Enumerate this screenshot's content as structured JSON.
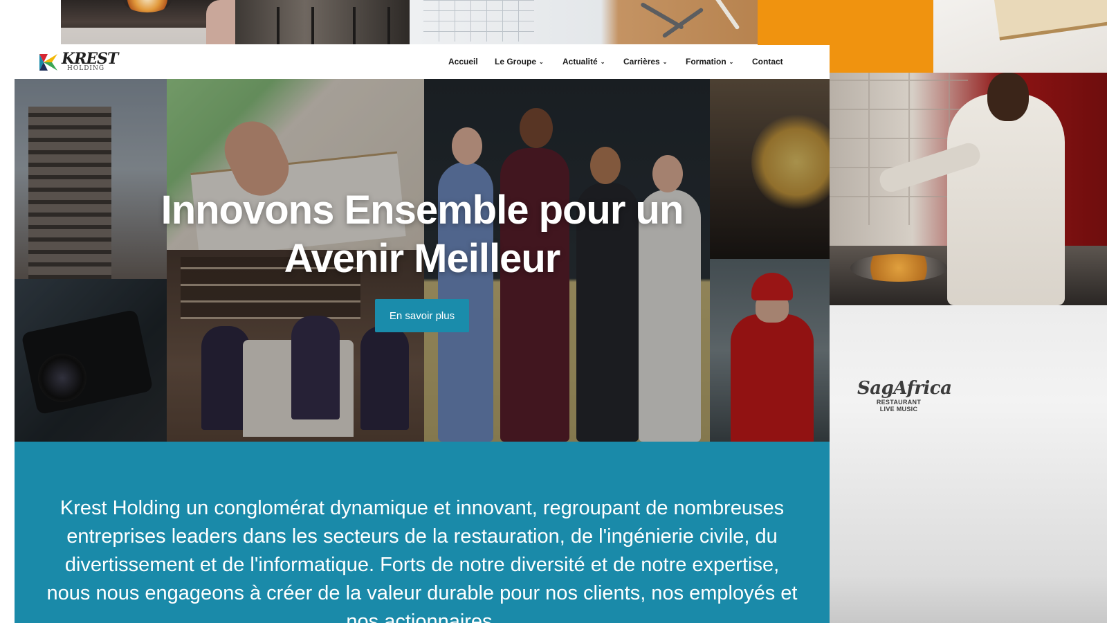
{
  "brand": {
    "name": "KREST",
    "sub": "HOLDING",
    "colors": {
      "red": "#d72631",
      "teal": "#1a8aa9",
      "navy": "#1f2f5a",
      "green": "#3aa655",
      "yellow": "#f2b705"
    },
    "icon": "krest-logo-mark"
  },
  "nav": {
    "items": [
      {
        "label": "Accueil",
        "dropdown": false
      },
      {
        "label": "Le Groupe",
        "dropdown": true
      },
      {
        "label": "Actualité",
        "dropdown": true
      },
      {
        "label": "Carrières",
        "dropdown": true
      },
      {
        "label": "Formation",
        "dropdown": true
      },
      {
        "label": "Contact",
        "dropdown": false
      }
    ],
    "dropdown_icon": "chevron-down-icon"
  },
  "hero": {
    "title_line1": "Innovons Ensemble pour un",
    "title_line2": "Avenir Meilleur",
    "button_label": "En savoir plus",
    "button_color": "#1a8cab"
  },
  "about": {
    "text": "Krest Holding un conglomérat dynamique et innovant, regroupant de nombreuses entreprises leaders dans les secteurs de la restauration, de l'ingénierie civile, du divertissement et de l'informatique. Forts de notre diversité et de notre expertise, nous nous engageons à créer de la valeur durable pour nos clients, nos employés et nos actionnaires.",
    "background": "#1a8aa9"
  },
  "side_brand": {
    "name": "SagAfrica",
    "line1": "RESTAURANT",
    "line2": "LIVE MUSIC"
  },
  "background_accent": "#f0930f"
}
